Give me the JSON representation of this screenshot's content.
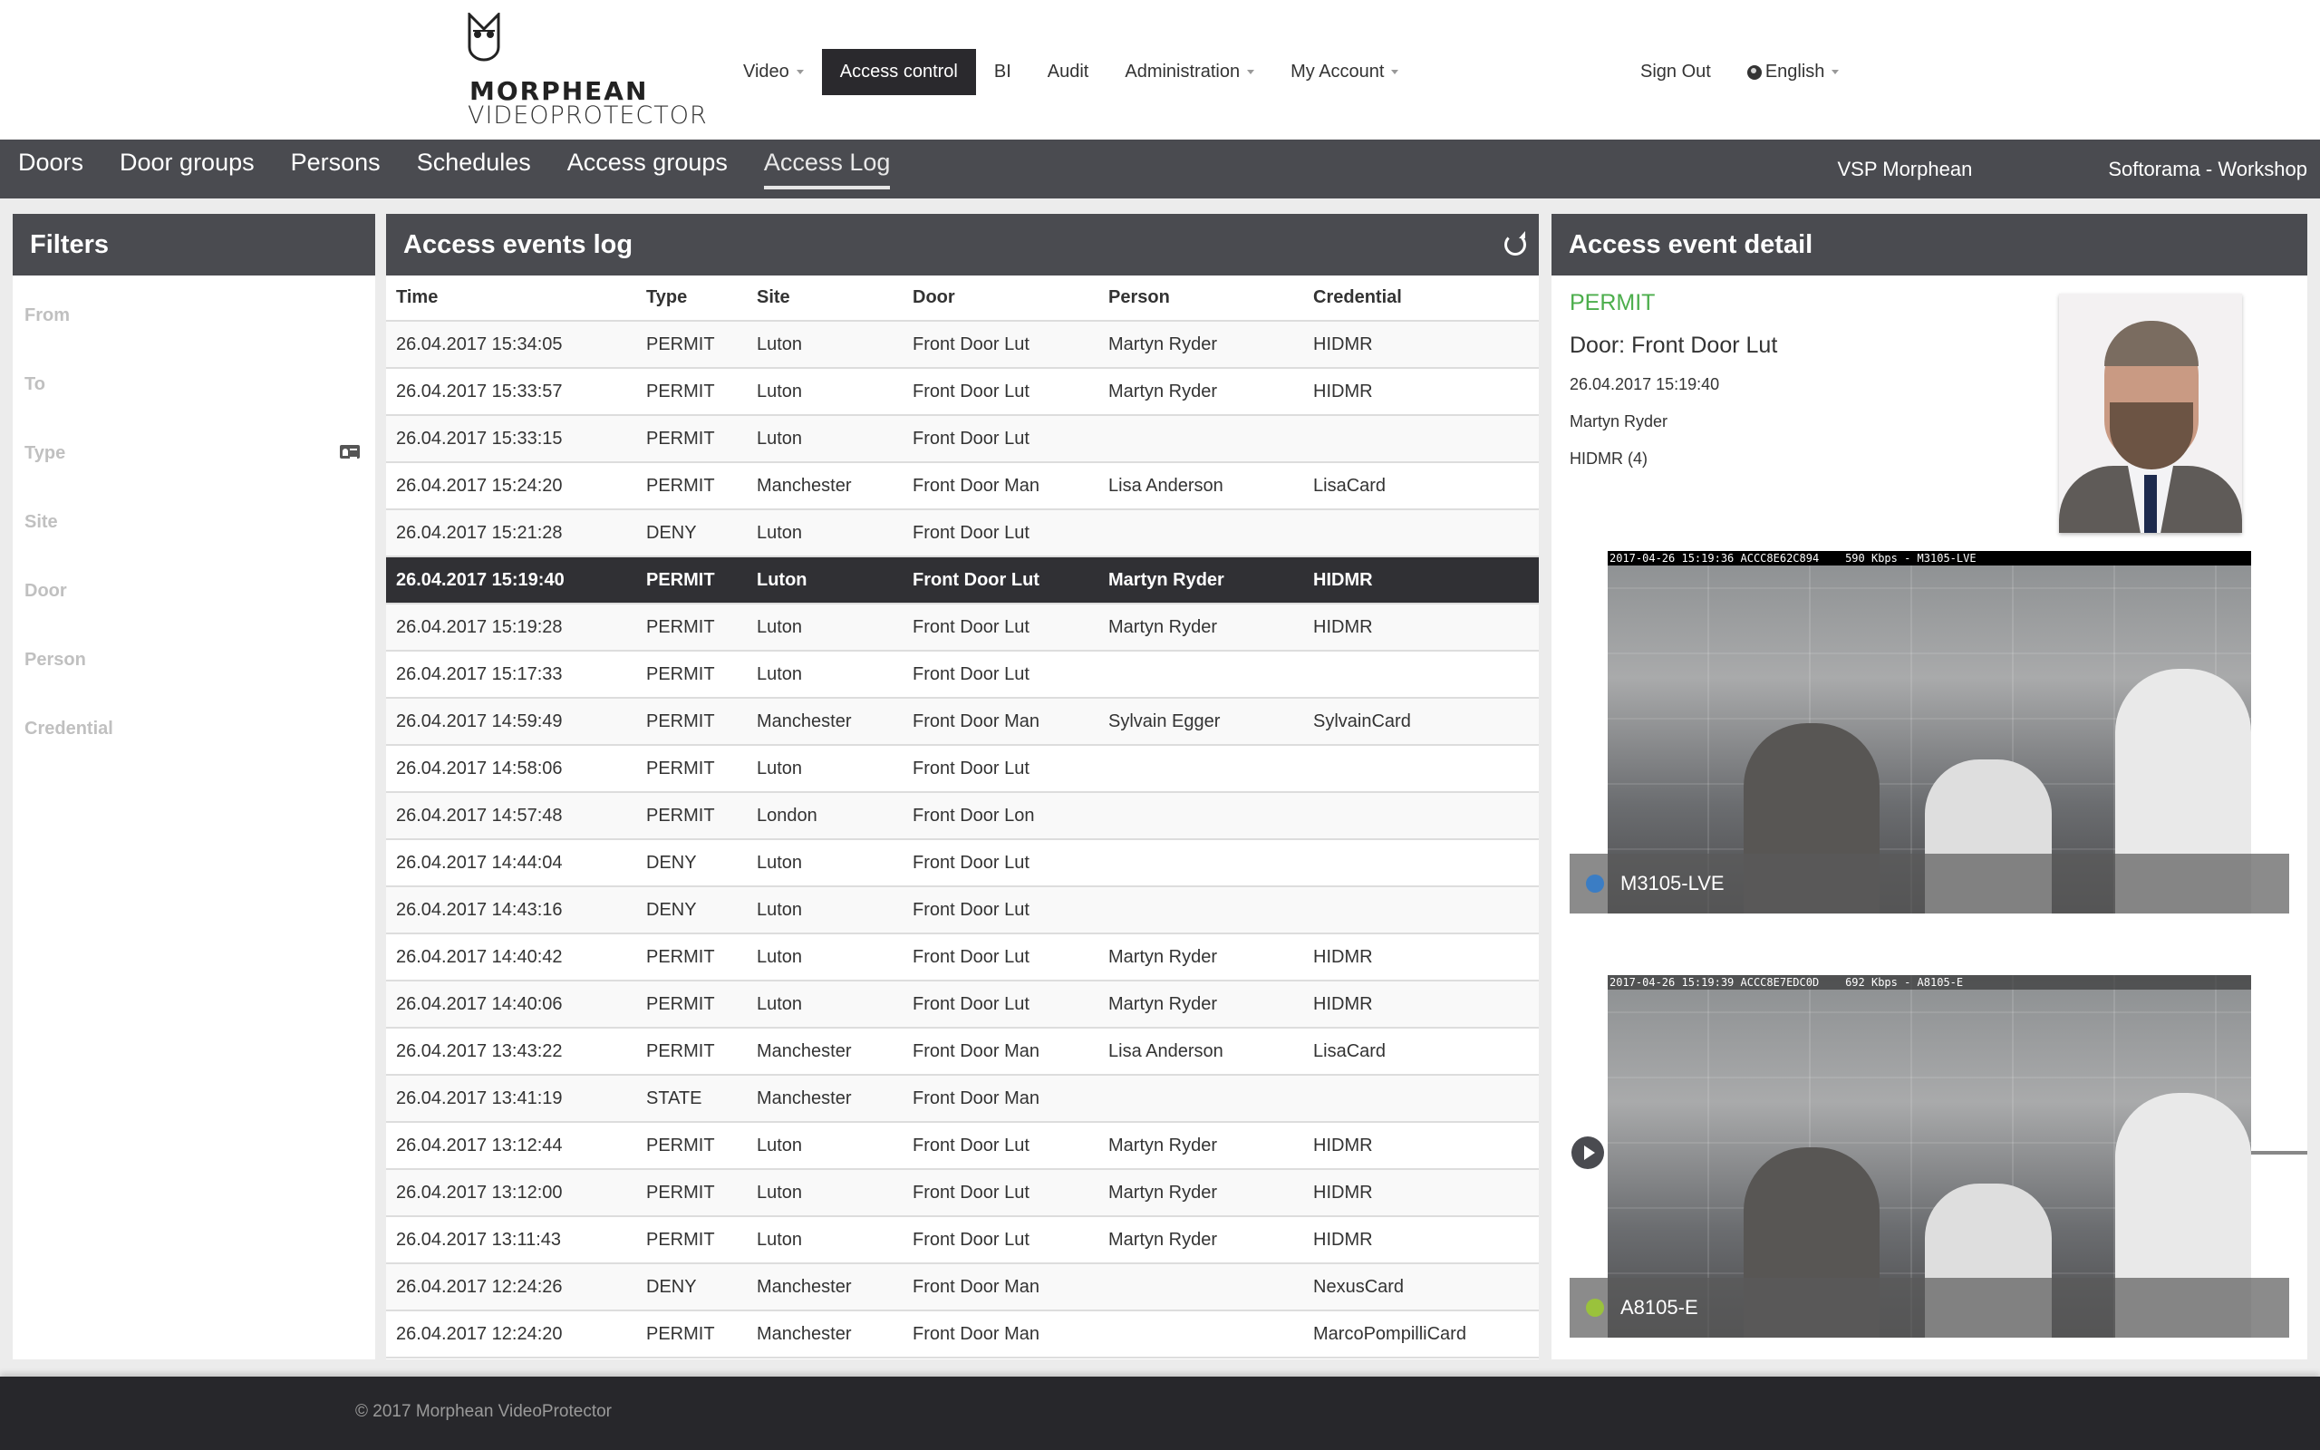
{
  "brand": {
    "line1": "MORPHEAN",
    "line2": "VIDEOPROTECTOR",
    "icon": "owl-logo-icon"
  },
  "main_nav": {
    "items": [
      {
        "label": "Video",
        "dropdown": true
      },
      {
        "label": "Access control",
        "active": true
      },
      {
        "label": "BI"
      },
      {
        "label": "Audit"
      },
      {
        "label": "Administration",
        "dropdown": true
      },
      {
        "label": "My Account",
        "dropdown": true
      }
    ],
    "sign_out": "Sign Out",
    "language": {
      "label": "English",
      "icon": "globe-icon"
    }
  },
  "sub_nav": {
    "tabs": [
      {
        "label": "Doors"
      },
      {
        "label": "Door groups"
      },
      {
        "label": "Persons"
      },
      {
        "label": "Schedules"
      },
      {
        "label": "Access groups"
      },
      {
        "label": "Access Log",
        "active": true
      }
    ],
    "organization": "VSP Morphean",
    "site": "Softorama - Workshop"
  },
  "filters": {
    "title": "Filters",
    "fields": [
      {
        "placeholder": "From"
      },
      {
        "placeholder": "To"
      },
      {
        "placeholder": "Type",
        "icon": "id-card-icon"
      },
      {
        "placeholder": "Site"
      },
      {
        "placeholder": "Door"
      },
      {
        "placeholder": "Person"
      },
      {
        "placeholder": "Credential"
      }
    ]
  },
  "log": {
    "title": "Access events log",
    "refresh_icon": "refresh-icon",
    "columns": [
      "Time",
      "Type",
      "Site",
      "Door",
      "Person",
      "Credential"
    ],
    "selected_index": 5,
    "rows": [
      {
        "time": "26.04.2017 15:34:05",
        "type": "PERMIT",
        "site": "Luton",
        "door": "Front Door Lut",
        "person": "Martyn Ryder",
        "credential": "HIDMR"
      },
      {
        "time": "26.04.2017 15:33:57",
        "type": "PERMIT",
        "site": "Luton",
        "door": "Front Door Lut",
        "person": "Martyn Ryder",
        "credential": "HIDMR"
      },
      {
        "time": "26.04.2017 15:33:15",
        "type": "PERMIT",
        "site": "Luton",
        "door": "Front Door Lut",
        "person": "",
        "credential": ""
      },
      {
        "time": "26.04.2017 15:24:20",
        "type": "PERMIT",
        "site": "Manchester",
        "door": "Front Door Man",
        "person": "Lisa Anderson",
        "credential": "LisaCard"
      },
      {
        "time": "26.04.2017 15:21:28",
        "type": "DENY",
        "site": "Luton",
        "door": "Front Door Lut",
        "person": "",
        "credential": ""
      },
      {
        "time": "26.04.2017 15:19:40",
        "type": "PERMIT",
        "site": "Luton",
        "door": "Front Door Lut",
        "person": "Martyn Ryder",
        "credential": "HIDMR"
      },
      {
        "time": "26.04.2017 15:19:28",
        "type": "PERMIT",
        "site": "Luton",
        "door": "Front Door Lut",
        "person": "Martyn Ryder",
        "credential": "HIDMR"
      },
      {
        "time": "26.04.2017 15:17:33",
        "type": "PERMIT",
        "site": "Luton",
        "door": "Front Door Lut",
        "person": "",
        "credential": ""
      },
      {
        "time": "26.04.2017 14:59:49",
        "type": "PERMIT",
        "site": "Manchester",
        "door": "Front Door Man",
        "person": "Sylvain Egger",
        "credential": "SylvainCard"
      },
      {
        "time": "26.04.2017 14:58:06",
        "type": "PERMIT",
        "site": "Luton",
        "door": "Front Door Lut",
        "person": "",
        "credential": ""
      },
      {
        "time": "26.04.2017 14:57:48",
        "type": "PERMIT",
        "site": "London",
        "door": "Front Door Lon",
        "person": "",
        "credential": ""
      },
      {
        "time": "26.04.2017 14:44:04",
        "type": "DENY",
        "site": "Luton",
        "door": "Front Door Lut",
        "person": "",
        "credential": ""
      },
      {
        "time": "26.04.2017 14:43:16",
        "type": "DENY",
        "site": "Luton",
        "door": "Front Door Lut",
        "person": "",
        "credential": ""
      },
      {
        "time": "26.04.2017 14:40:42",
        "type": "PERMIT",
        "site": "Luton",
        "door": "Front Door Lut",
        "person": "Martyn Ryder",
        "credential": "HIDMR"
      },
      {
        "time": "26.04.2017 14:40:06",
        "type": "PERMIT",
        "site": "Luton",
        "door": "Front Door Lut",
        "person": "Martyn Ryder",
        "credential": "HIDMR"
      },
      {
        "time": "26.04.2017 13:43:22",
        "type": "PERMIT",
        "site": "Manchester",
        "door": "Front Door Man",
        "person": "Lisa Anderson",
        "credential": "LisaCard"
      },
      {
        "time": "26.04.2017 13:41:19",
        "type": "STATE",
        "site": "Manchester",
        "door": "Front Door Man",
        "person": "",
        "credential": ""
      },
      {
        "time": "26.04.2017 13:12:44",
        "type": "PERMIT",
        "site": "Luton",
        "door": "Front Door Lut",
        "person": "Martyn Ryder",
        "credential": "HIDMR"
      },
      {
        "time": "26.04.2017 13:12:00",
        "type": "PERMIT",
        "site": "Luton",
        "door": "Front Door Lut",
        "person": "Martyn Ryder",
        "credential": "HIDMR"
      },
      {
        "time": "26.04.2017 13:11:43",
        "type": "PERMIT",
        "site": "Luton",
        "door": "Front Door Lut",
        "person": "Martyn Ryder",
        "credential": "HIDMR"
      },
      {
        "time": "26.04.2017 12:24:26",
        "type": "DENY",
        "site": "Manchester",
        "door": "Front Door Man",
        "person": "",
        "credential": "NexusCard"
      },
      {
        "time": "26.04.2017 12:24:20",
        "type": "PERMIT",
        "site": "Manchester",
        "door": "Front Door Man",
        "person": "",
        "credential": "MarcoPompilliCard"
      }
    ]
  },
  "detail": {
    "title": "Access event detail",
    "status": "PERMIT",
    "status_color": "#4cae4c",
    "door": "Door: Front Door Lut",
    "time": "26.04.2017 15:19:40",
    "person": "Martyn Ryder",
    "credential": "HIDMR (4)",
    "photo": "person-photo",
    "cameras": [
      {
        "name": "M3105-LVE",
        "osd": "2017-04-26 15:19:36 ACCC8E62C894    590 Kbps - M3105-LVE",
        "dot_color": "#3b7dc4"
      },
      {
        "name": "A8105-E",
        "osd": "2017-04-26 15:19:39 ACCC8E7EDC0D    692 Kbps - A8105-E",
        "dot_color": "#9ac23c"
      }
    ],
    "playback": {
      "position_fraction": 0.12,
      "play_icon": "play-icon"
    }
  },
  "footer": {
    "copyright": "© 2017 Morphean VideoProtector"
  }
}
